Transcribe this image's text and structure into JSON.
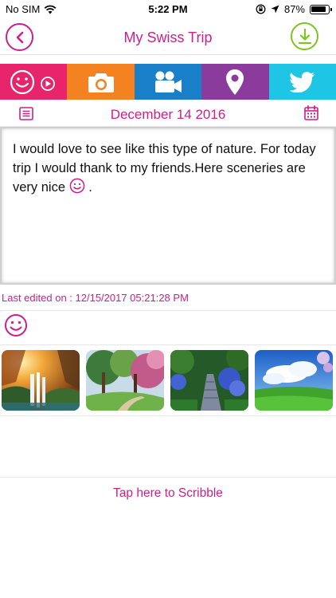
{
  "status": {
    "carrier": "No SIM",
    "time": "5:22 PM",
    "battery": "87%"
  },
  "header": {
    "title": "My Swiss Trip",
    "back_icon": "chevron-left-icon",
    "download_icon": "download-icon"
  },
  "toolbar": {
    "items": [
      {
        "icon": "mood-video-icon",
        "color": "#e8246a"
      },
      {
        "icon": "camera-icon",
        "color": "#f58220"
      },
      {
        "icon": "video-camera-icon",
        "color": "#1a7fc9"
      },
      {
        "icon": "map-pin-icon",
        "color": "#8b3b9c"
      },
      {
        "icon": "twitter-icon",
        "color": "#1ec5e5"
      }
    ]
  },
  "entry": {
    "date": "December 14 2016",
    "text": "I would love to see like this type of nature. For today trip I would thank to my friends.Here sceneries are very nice",
    "text_end": ".",
    "last_edited": "Last edited on : 12/15/2017 05:21:28 PM"
  },
  "photos": [
    {
      "name": "waterfall-forest-photo"
    },
    {
      "name": "spring-trees-photo"
    },
    {
      "name": "flower-garden-path-photo"
    },
    {
      "name": "green-meadow-sky-photo"
    }
  ],
  "scribble": {
    "label": "Tap here to Scribble"
  },
  "colors": {
    "accent": "#cc1f8a",
    "download": "#7ec322"
  }
}
